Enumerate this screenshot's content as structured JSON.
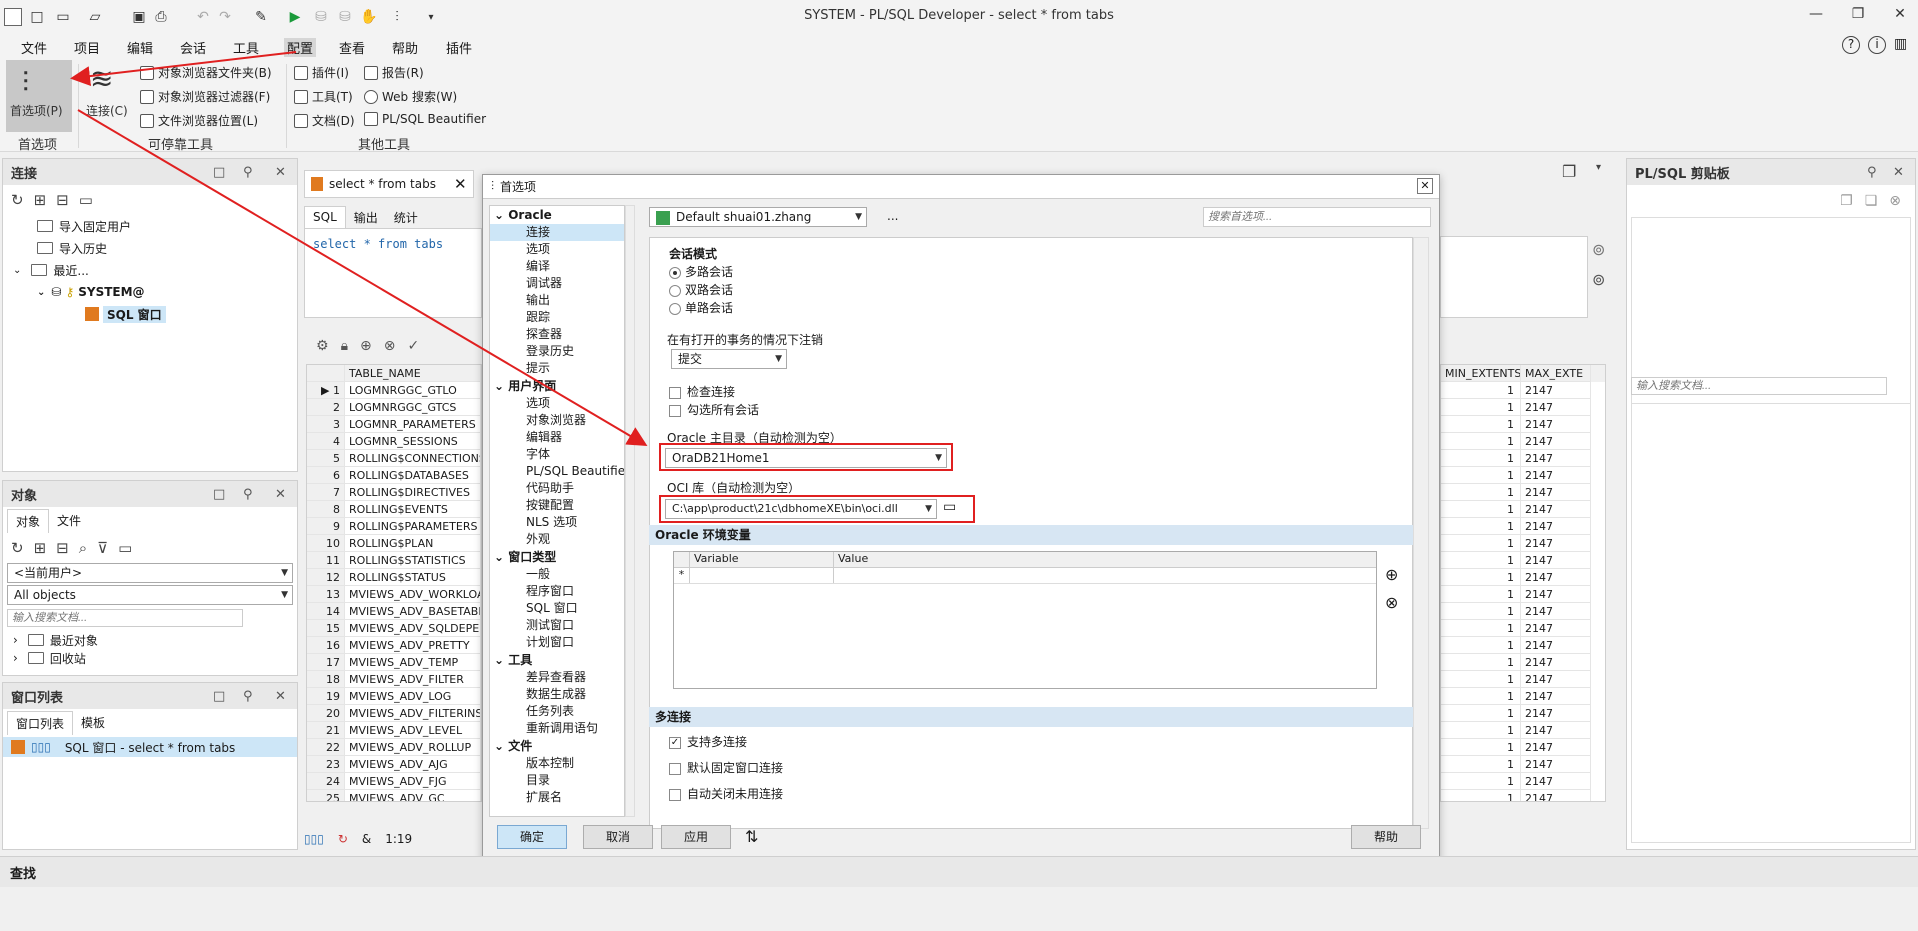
{
  "app": {
    "title": "SYSTEM - PL/SQL Developer - select * from tabs"
  },
  "menu": [
    "文件",
    "项目",
    "编辑",
    "会话",
    "工具",
    "配置",
    "查看",
    "帮助",
    "插件"
  ],
  "ribbon": {
    "pref_label": "首选项(P)",
    "group1": "首选项",
    "conn_label": "连接(C)",
    "dock_items": [
      "对象浏览器文件夹(B)",
      "对象浏览器过滤器(F)",
      "文件浏览器位置(L)"
    ],
    "group2": "可停靠工具",
    "other_items": [
      "插件(I)",
      "报告(R)",
      "工具(T)",
      "Web 搜索(W)",
      "文档(D)",
      "PL/SQL Beautifier"
    ],
    "group3": "其他工具"
  },
  "conn_panel": {
    "title": "连接",
    "items": [
      "导入固定用户",
      "导入历史",
      "最近...",
      "SYSTEM@",
      "SQL 窗口"
    ]
  },
  "obj_panel": {
    "title": "对象",
    "tabs": [
      "对象",
      "文件"
    ],
    "user_select": "<当前用户>",
    "type_select": "All objects",
    "search_placeholder": "输入搜索文档...",
    "items": [
      "最近对象",
      "回收站"
    ]
  },
  "win_panel": {
    "title": "窗口列表",
    "tabs": [
      "窗口列表",
      "模板"
    ],
    "item": "SQL 窗口 - select * from tabs"
  },
  "editor": {
    "tab": "select * from tabs",
    "subtabs": [
      "SQL",
      "输出",
      "统计"
    ],
    "sql": "select * from tabs",
    "col_header": "TABLE_NAME",
    "col_min": "MIN_EXTENTS",
    "col_max": "MAX_EXTE",
    "rows": [
      "LOGMNRGGC_GTLO",
      "LOGMNRGGC_GTCS",
      "LOGMNR_PARAMETERS",
      "LOGMNR_SESSIONS",
      "ROLLING$CONNECTIONS",
      "ROLLING$DATABASES",
      "ROLLING$DIRECTIVES",
      "ROLLING$EVENTS",
      "ROLLING$PARAMETERS",
      "ROLLING$PLAN",
      "ROLLING$STATISTICS",
      "ROLLING$STATUS",
      "MVIEWS_ADV_WORKLOA",
      "MVIEWS_ADV_BASETABLE",
      "MVIEWS_ADV_SQLDEPEN",
      "MVIEWS_ADV_PRETTY",
      "MVIEWS_ADV_TEMP",
      "MVIEWS_ADV_FILTER",
      "MVIEWS_ADV_LOG",
      "MVIEWS_ADV_FILTERINST",
      "MVIEWS_ADV_LEVEL",
      "MVIEWS_ADV_ROLLUP",
      "MVIEWS_ADV_AJG",
      "MVIEWS_ADV_FJG",
      "MVIEWS_ADV_GC"
    ],
    "min_val": "1",
    "max_val": "2147",
    "cursor": "1:19"
  },
  "clipboard": {
    "title": "PL/SQL 剪贴板",
    "search_placeholder": "输入搜索文档..."
  },
  "dialog": {
    "title": "首选项",
    "tree": [
      {
        "h": "Oracle",
        "items": [
          "连接",
          "选项",
          "编译",
          "调试器",
          "输出",
          "跟踪",
          "探查器",
          "登录历史",
          "提示"
        ]
      },
      {
        "h": "用户界面",
        "items": [
          "选项",
          "对象浏览器",
          "编辑器",
          "字体",
          "PL/SQL Beautifier",
          "代码助手",
          "按键配置",
          "NLS 选项",
          "外观"
        ]
      },
      {
        "h": "窗口类型",
        "items": [
          "一般",
          "程序窗口",
          "SQL 窗口",
          "测试窗口",
          "计划窗口"
        ]
      },
      {
        "h": "工具",
        "items": [
          "差异查看器",
          "数据生成器",
          "任务列表",
          "重新调用语句"
        ]
      },
      {
        "h": "文件",
        "items": [
          "版本控制",
          "目录",
          "扩展名"
        ]
      }
    ],
    "profile": "Default shuai01.zhang",
    "more": "...",
    "search_placeholder": "搜索首选项...",
    "session_mode": "会话模式",
    "modes": [
      "多路会话",
      "双路会话",
      "单路会话"
    ],
    "commit_label": "在有打开的事务的情况下注销",
    "commit_value": "提交",
    "check_conn": "检查连接",
    "check_all": "勾选所有会话",
    "oracle_home_label": "Oracle 主目录（自动检测为空）",
    "oracle_home_value": "OraDB21Home1",
    "oci_label": "OCI 库（自动检测为空）",
    "oci_value": "C:\\app\\product\\21c\\dbhomeXE\\bin\\oci.dll",
    "env_header": "Oracle 环境变量",
    "env_cols": [
      "Variable",
      "Value"
    ],
    "env_star": "*",
    "multi_header": "多连接",
    "multi": [
      "支持多连接",
      "默认固定窗口连接",
      "自动关闭未用连接"
    ],
    "buttons": {
      "ok": "确定",
      "cancel": "取消",
      "apply": "应用",
      "help": "帮助"
    }
  },
  "status": {
    "find": "查找"
  }
}
